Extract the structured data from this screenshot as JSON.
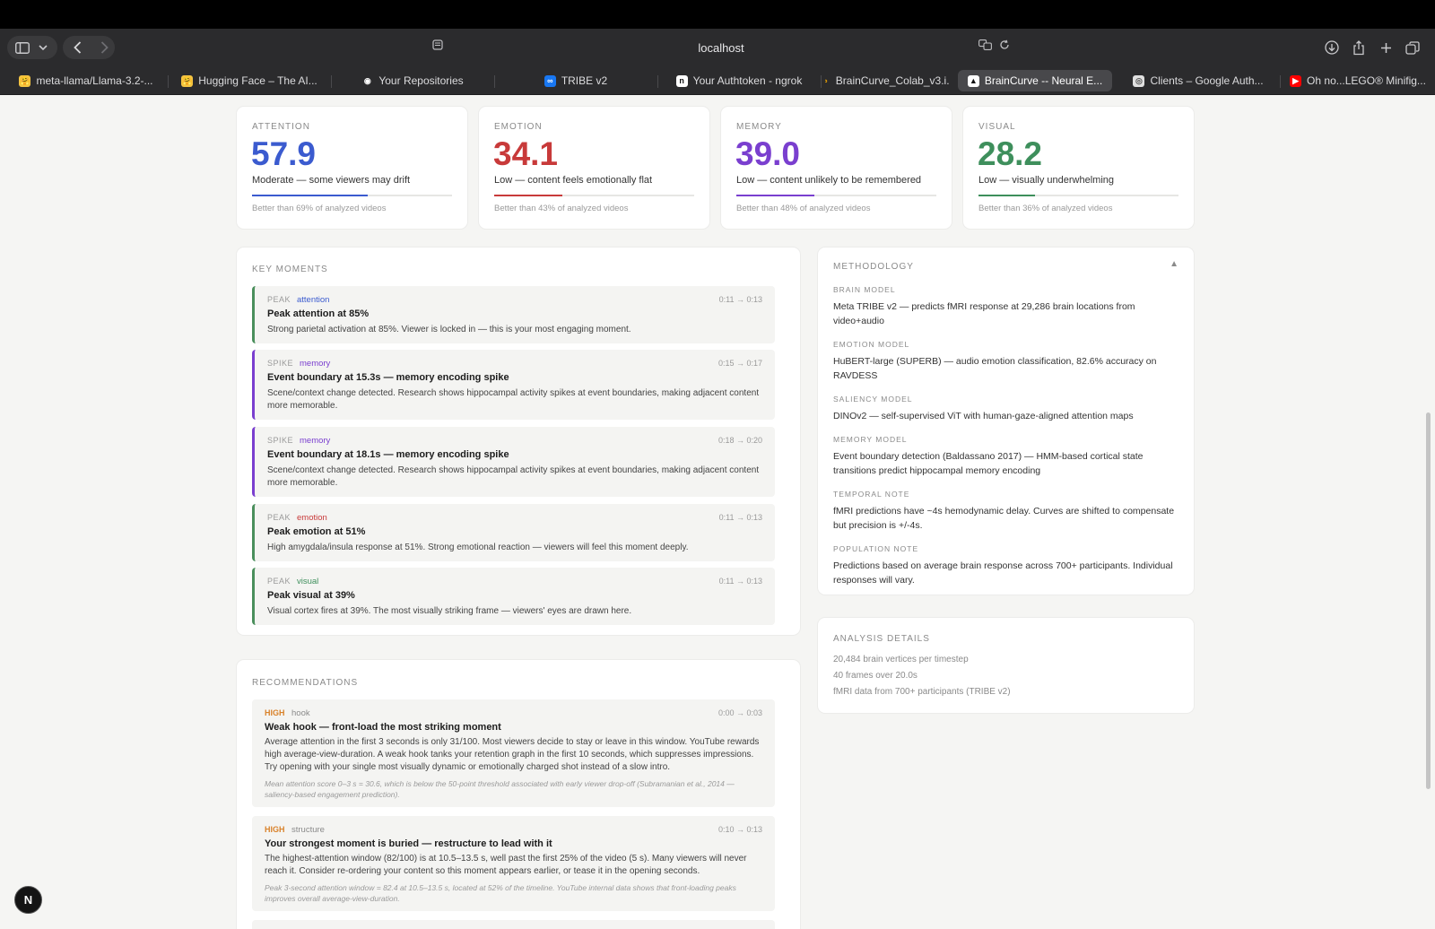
{
  "browser": {
    "url": "localhost",
    "tabs": [
      {
        "label": "meta-llama/Llama-3.2-...",
        "fav": "🤗",
        "favbg": "#f5c542"
      },
      {
        "label": "Hugging Face – The AI...",
        "fav": "🤗",
        "favbg": "#f5c542"
      },
      {
        "label": "Your Repositories",
        "fav": "◉",
        "favbg": "#ffffff"
      },
      {
        "label": "TRIBE v2",
        "fav": "∞",
        "favbg": "#1877f2"
      },
      {
        "label": "Your Authtoken - ngrok",
        "fav": "n",
        "favbg": "#ffffff"
      },
      {
        "label": "BrainCurve_Colab_v3.i...",
        "fav": "∞",
        "favbg": "#f9ab00"
      },
      {
        "label": "BrainCurve -- Neural E...",
        "fav": "▲",
        "favbg": "#ffffff"
      },
      {
        "label": "Clients – Google Auth...",
        "fav": "◎",
        "favbg": "#e0e0e0"
      },
      {
        "label": "Oh no...LEGO® Minifig...",
        "fav": "▶",
        "favbg": "#ff0000"
      }
    ]
  },
  "metrics": [
    {
      "label": "ATTENTION",
      "value": "57.9",
      "desc": "Moderate — some viewers may drift",
      "cmp": "Better than 69% of analyzed videos",
      "fill": 0.579,
      "color": "#3b5bcf"
    },
    {
      "label": "EMOTION",
      "value": "34.1",
      "desc": "Low — content feels emotionally flat",
      "cmp": "Better than 43% of analyzed videos",
      "fill": 0.341,
      "color": "#c83a3a"
    },
    {
      "label": "MEMORY",
      "value": "39.0",
      "desc": "Low — content unlikely to be remembered",
      "cmp": "Better than 48% of analyzed videos",
      "fill": 0.39,
      "color": "#7a3fcf"
    },
    {
      "label": "VISUAL",
      "value": "28.2",
      "desc": "Low — visually underwhelming",
      "cmp": "Better than 36% of analyzed videos",
      "fill": 0.282,
      "color": "#3e8f5c"
    }
  ],
  "key_moments": {
    "title": "KEY MOMENTS",
    "items": [
      {
        "kind": "PEAK",
        "tag": "attention",
        "tagcolor": "#3b5bcf",
        "border": "#4a8f5c",
        "time": "0:11 → 0:13",
        "title": "Peak attention at 85%",
        "text": "Strong parietal activation at 85%. Viewer is locked in — this is your most engaging moment."
      },
      {
        "kind": "SPIKE",
        "tag": "memory",
        "tagcolor": "#7a3fcf",
        "border": "#7a3fcf",
        "time": "0:15 → 0:17",
        "title": "Event boundary at 15.3s — memory encoding spike",
        "text": "Scene/context change detected. Research shows hippocampal activity spikes at event boundaries, making adjacent content more memorable."
      },
      {
        "kind": "SPIKE",
        "tag": "memory",
        "tagcolor": "#7a3fcf",
        "border": "#7a3fcf",
        "time": "0:18 → 0:20",
        "title": "Event boundary at 18.1s — memory encoding spike",
        "text": "Scene/context change detected. Research shows hippocampal activity spikes at event boundaries, making adjacent content more memorable."
      },
      {
        "kind": "PEAK",
        "tag": "emotion",
        "tagcolor": "#c83a3a",
        "border": "#4a8f5c",
        "time": "0:11 → 0:13",
        "title": "Peak emotion at 51%",
        "text": "High amygdala/insula response at 51%. Strong emotional reaction — viewers will feel this moment deeply."
      },
      {
        "kind": "PEAK",
        "tag": "visual",
        "tagcolor": "#3e8f5c",
        "border": "#4a8f5c",
        "time": "0:11 → 0:13",
        "title": "Peak visual at 39%",
        "text": "Visual cortex fires at 39%. The most visually striking frame — viewers' eyes are drawn here."
      }
    ]
  },
  "recommendations": {
    "title": "RECOMMENDATIONS",
    "items": [
      {
        "priority": "HIGH",
        "category": "hook",
        "time": "0:00 → 0:03",
        "title": "Weak hook — front-load the most striking moment",
        "text": "Average attention in the first 3 seconds is only 31/100. Most viewers decide to stay or leave in this window. YouTube rewards high average-view-duration. A weak hook tanks your retention graph in the first 10 seconds, which suppresses impressions. Try opening with your single most visually dynamic or emotionally charged shot instead of a slow intro.",
        "note": "Mean attention score 0–3 s = 30.6, which is below the 50-point threshold associated with early viewer drop-off (Subramanian et al., 2014 — saliency-based engagement prediction)."
      },
      {
        "priority": "HIGH",
        "category": "structure",
        "time": "0:10 → 0:13",
        "title": "Your strongest moment is buried — restructure to lead with it",
        "text": "The highest-attention window (82/100) is at 10.5–13.5 s, well past the first 25% of the video (5 s). Many viewers will never reach it. Consider re-ordering your content so this moment appears earlier, or tease it in the opening seconds.",
        "note": "Peak 3-second attention window = 82.4 at 10.5–13.5 s, located at 52% of the timeline. YouTube internal data shows that front-loading peaks improves overall average-view-duration."
      }
    ]
  },
  "methodology": {
    "title": "METHODOLOGY",
    "toggle": "▲",
    "items": [
      {
        "heading": "BRAIN MODEL",
        "body": "Meta TRIBE v2 — predicts fMRI response at 29,286 brain locations from video+audio"
      },
      {
        "heading": "EMOTION MODEL",
        "body": "HuBERT-large (SUPERB) — audio emotion classification, 82.6% accuracy on RAVDESS"
      },
      {
        "heading": "SALIENCY MODEL",
        "body": "DINOv2 — self-supervised ViT with human-gaze-aligned attention maps"
      },
      {
        "heading": "MEMORY MODEL",
        "body": "Event boundary detection (Baldassano 2017) — HMM-based cortical state transitions predict hippocampal memory encoding"
      },
      {
        "heading": "TEMPORAL NOTE",
        "body": "fMRI predictions have ~4s hemodynamic delay. Curves are shifted to compensate but precision is +/-4s."
      },
      {
        "heading": "POPULATION NOTE",
        "body": "Predictions based on average brain response across 700+ participants. Individual responses will vary."
      }
    ]
  },
  "analysis_details": {
    "title": "ANALYSIS DETAILS",
    "lines": [
      "20,484 brain vertices per timestep",
      "40 frames over 20.0s",
      "fMRI data from 700+ participants (TRIBE v2)"
    ]
  },
  "badge": "N"
}
